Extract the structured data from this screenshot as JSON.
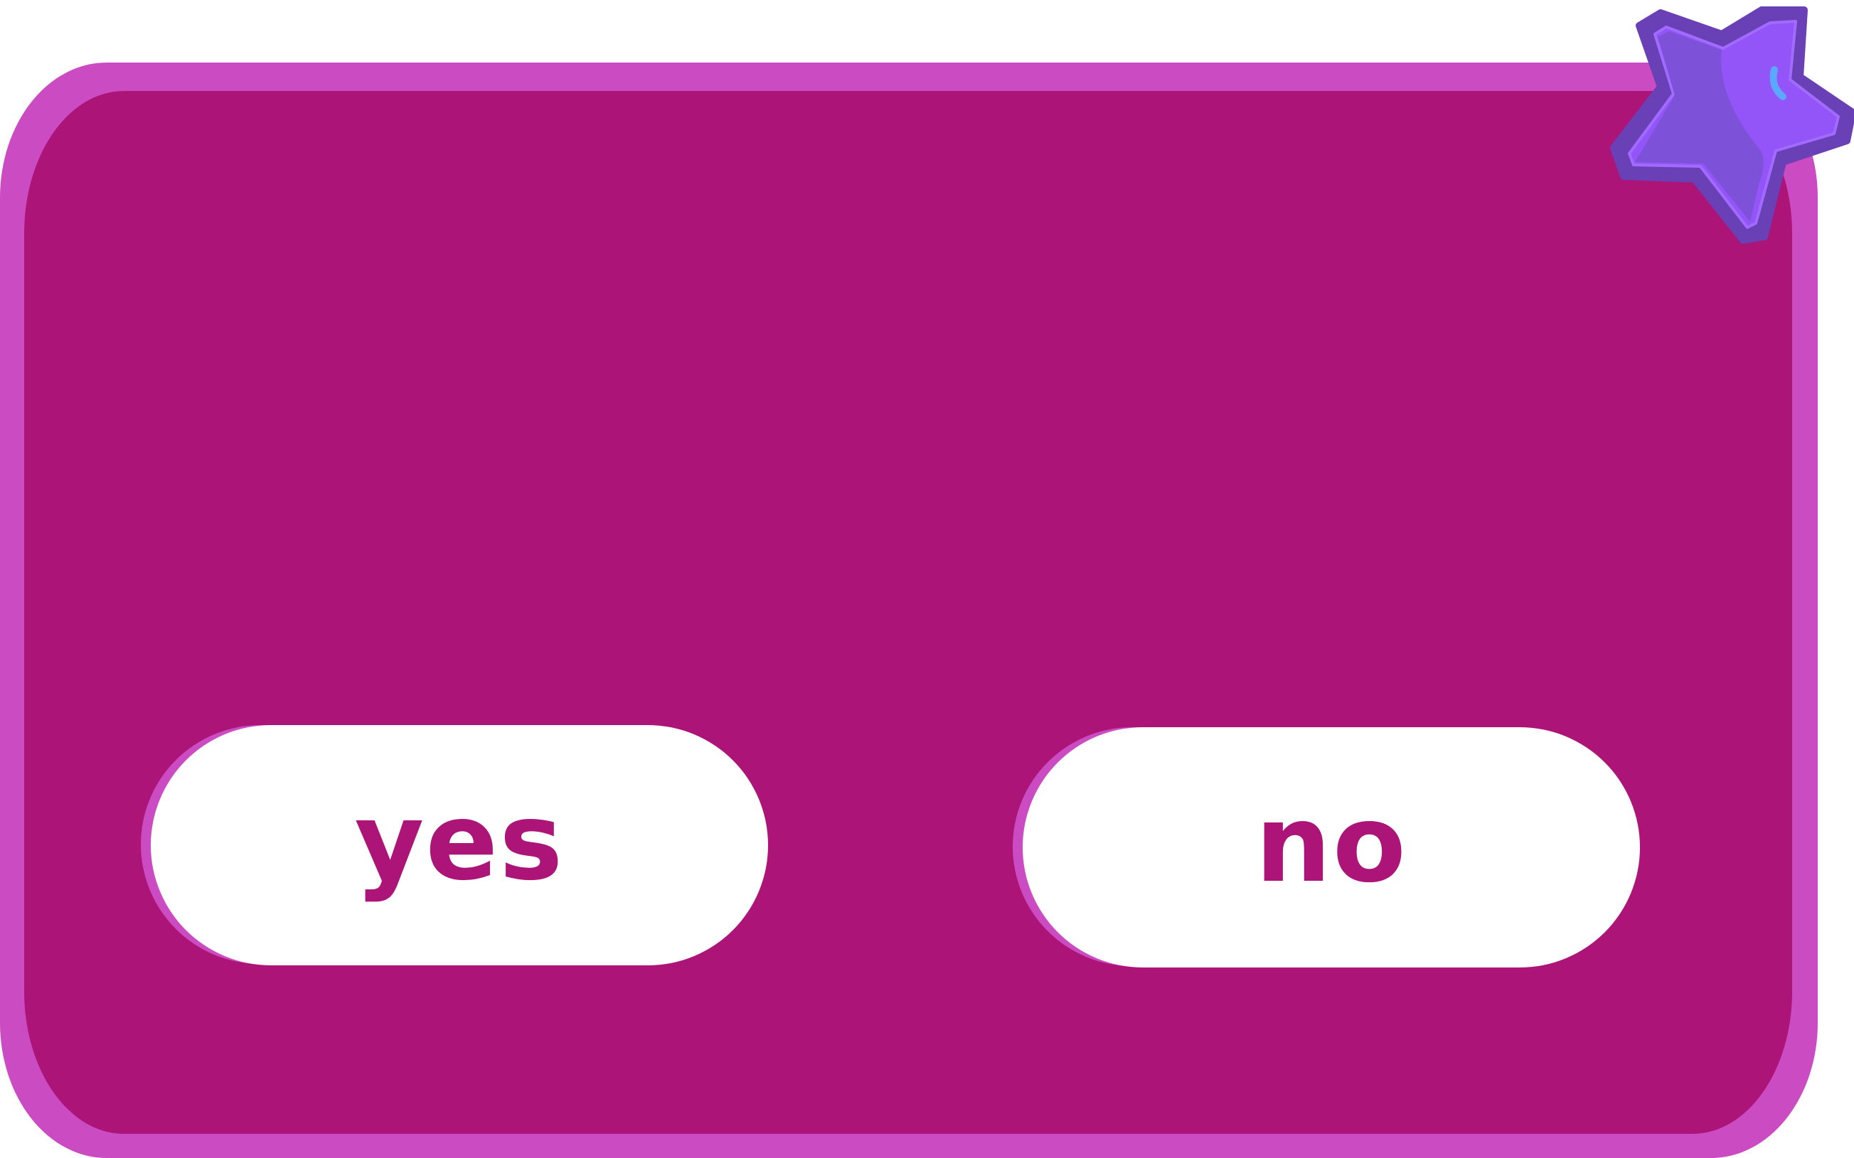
{
  "dialog": {
    "buttons": {
      "yes": {
        "label": "yes"
      },
      "no": {
        "label": "no"
      }
    },
    "decoration": {
      "icon": "star-icon"
    }
  },
  "colors": {
    "frame": "#ca4bc2",
    "panel": "#ac1577",
    "button_face": "#ffffff",
    "button_text": "#ac1577",
    "star_fill": "#9354f8",
    "star_shade": "#7e52d8",
    "star_outline": "#6940b5",
    "star_highlight": "#5aa8ff"
  }
}
